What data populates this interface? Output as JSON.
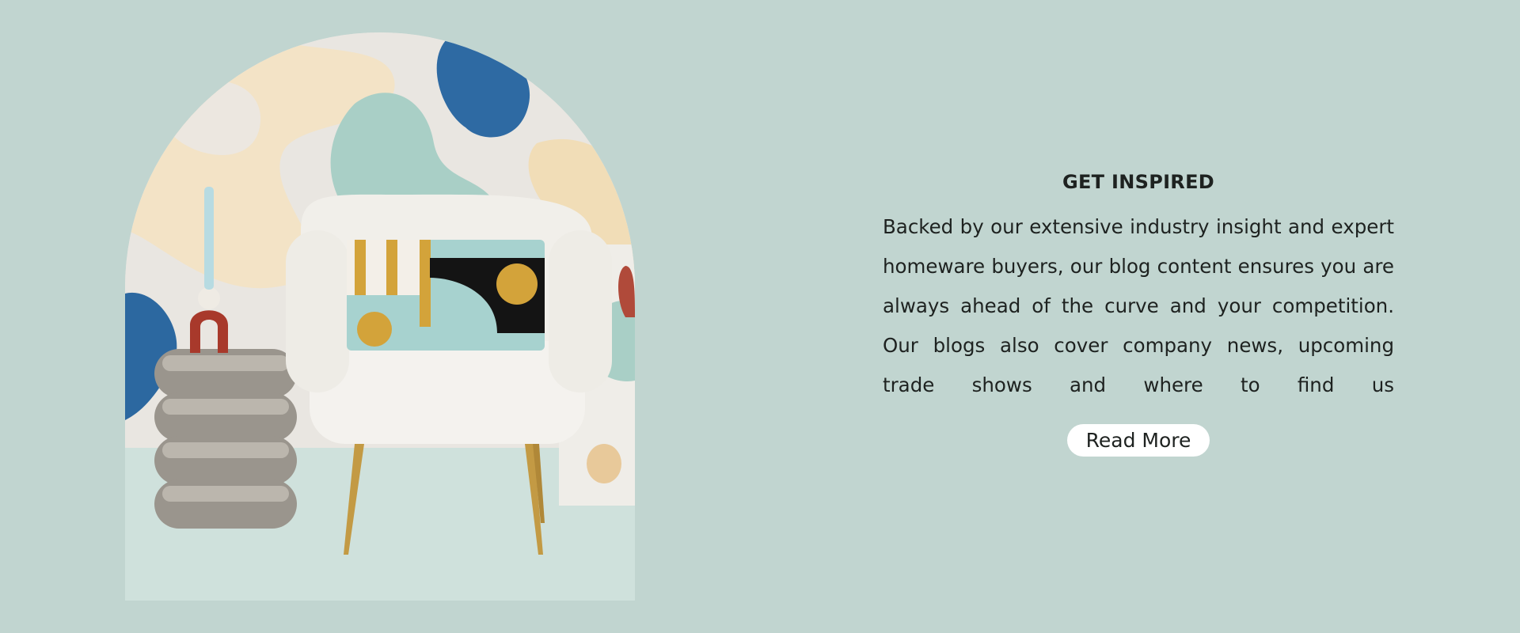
{
  "section": {
    "heading": "GET INSPIRED",
    "body": "Backed by our extensive industry insight and expert homeware buyers, our blog content ensures you are always ahead of the curve and your competition. Our blogs also cover company news, upcoming trade shows and where to find us",
    "cta_label": "Read More"
  },
  "colors": {
    "background": "#c1d5d0",
    "text": "#1e2220",
    "button_bg": "#ffffff"
  },
  "image": {
    "subject": "boucle-armchair-with-side-table"
  }
}
